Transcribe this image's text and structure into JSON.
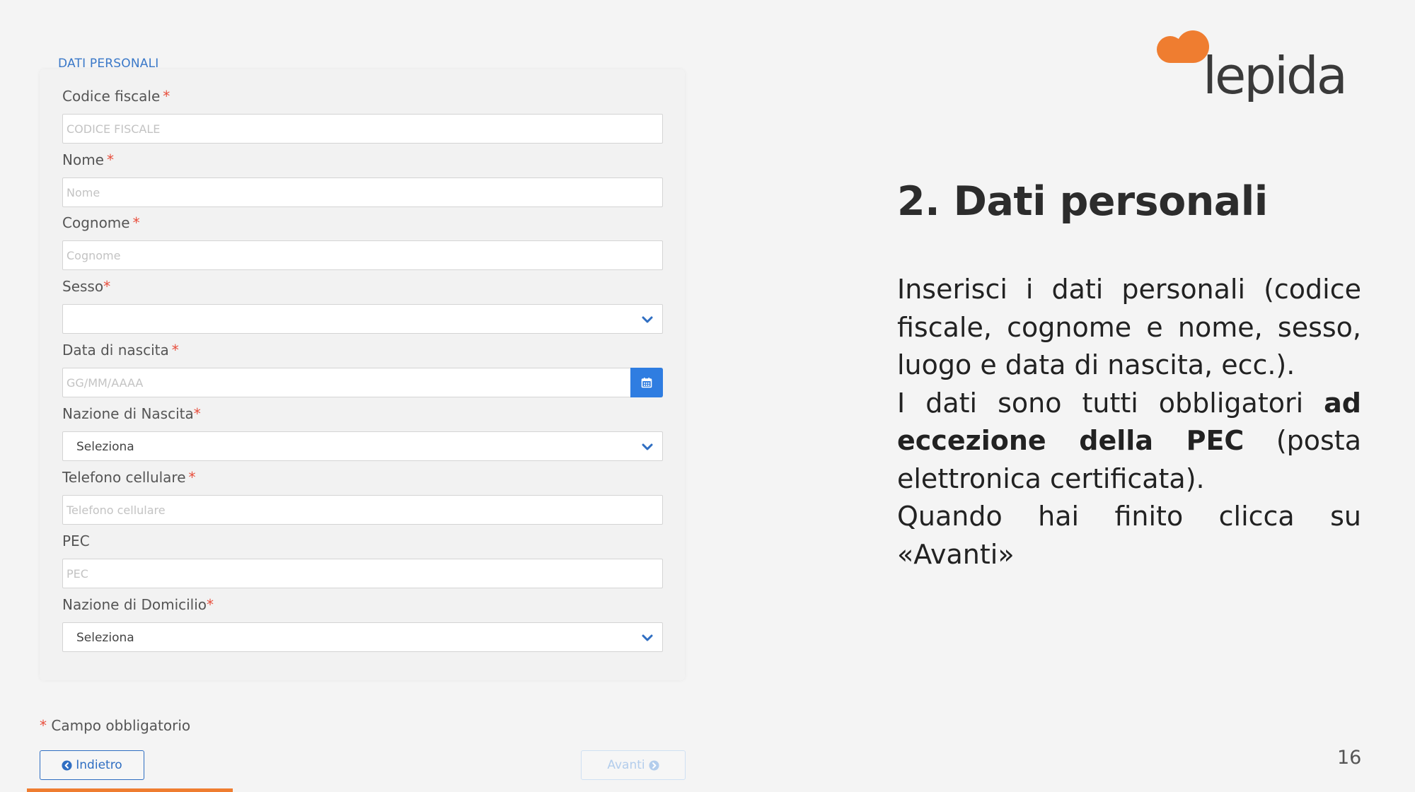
{
  "form": {
    "section_title": "DATI PERSONALI",
    "fields": {
      "codice_fiscale": {
        "label": "Codice fiscale",
        "required_mark": "*",
        "placeholder": "CODICE FISCALE"
      },
      "nome": {
        "label": "Nome",
        "required_mark": "*",
        "placeholder": "Nome"
      },
      "cognome": {
        "label": "Cognome",
        "required_mark": "*",
        "placeholder": "Cognome"
      },
      "sesso": {
        "label": "Sesso",
        "required_mark": "*",
        "value": ""
      },
      "data_nascita": {
        "label": "Data di nascita",
        "required_mark": "*",
        "placeholder": "GG/MM/AAAA"
      },
      "nazione_nascita": {
        "label": "Nazione di Nascita",
        "required_mark": "*",
        "value": "Seleziona"
      },
      "telefono": {
        "label": "Telefono cellulare",
        "required_mark": "*",
        "placeholder": "Telefono cellulare"
      },
      "pec": {
        "label": "PEC",
        "placeholder": "PEC"
      },
      "nazione_domicilio": {
        "label": "Nazione di Domicilio",
        "required_mark": "*",
        "value": "Seleziona"
      }
    },
    "required_note_mark": "*",
    "required_note": "Campo obbligatorio",
    "back_label": "Indietro",
    "next_label": "Avanti"
  },
  "slide": {
    "logo_text": "lepida",
    "title": "2. Dati personali",
    "para1": "Inserisci i dati personali (codice fiscale, cognome e nome,  sesso, luogo e data di nascita, ecc.).",
    "para2_start": "I dati sono tutti obbligatori ",
    "para2_bold": "ad eccezione della PEC",
    "para2_end": " (posta elettronica certificata).",
    "para3": "Quando hai finito clicca su «Avanti»",
    "page_number": "16"
  },
  "colors": {
    "accent_blue": "#2f7de1",
    "required_red": "#e84e3c",
    "brand_orange": "#ef7d30",
    "brand_dark": "#3a3a3a"
  }
}
